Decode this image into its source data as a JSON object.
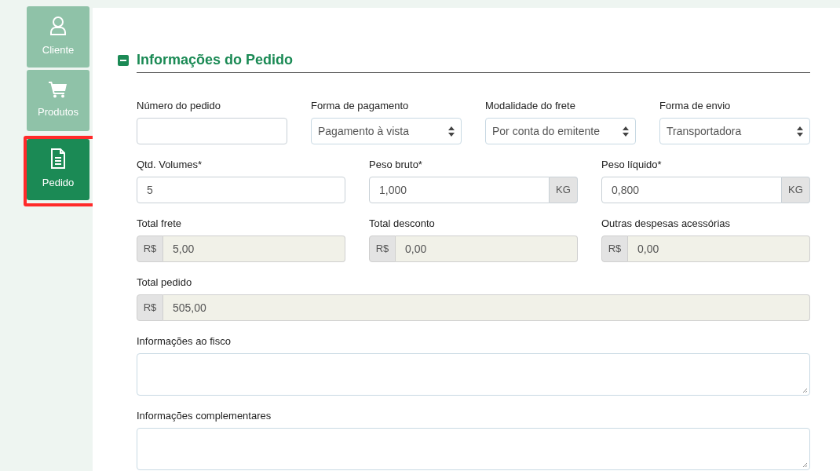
{
  "sidebar": {
    "items": [
      {
        "label": "Cliente",
        "selected": false,
        "highlighted": false
      },
      {
        "label": "Produtos",
        "selected": false,
        "highlighted": false
      },
      {
        "label": "Pedido",
        "selected": true,
        "highlighted": true
      }
    ]
  },
  "section": {
    "title": "Informações do Pedido",
    "expanded": true
  },
  "form_rows": [
    [
      {
        "kind": "text",
        "label": "Número do pedido"
      },
      {
        "kind": "select",
        "label": "Forma de pagamento",
        "value": "Pagamento à vista"
      },
      {
        "kind": "select",
        "label": "Modalidade do frete",
        "value": "Por conta do emitente"
      },
      {
        "kind": "select",
        "label": "Forma de envio",
        "value": "Transportadora"
      }
    ],
    [
      {
        "kind": "text",
        "label": "Qtd. Volumes*",
        "value": "5"
      },
      {
        "kind": "unit",
        "label": "Peso bruto*",
        "value": "1,000",
        "unit": "KG"
      },
      {
        "kind": "unit",
        "label": "Peso líquido*",
        "value": "0,800",
        "unit": "KG"
      }
    ],
    [
      {
        "kind": "prefix",
        "label": "Total frete",
        "prefix": "R$",
        "value": "5,00",
        "readonly": true
      },
      {
        "kind": "prefix",
        "label": "Total desconto",
        "prefix": "R$",
        "value": "0,00",
        "readonly": true
      },
      {
        "kind": "prefix",
        "label": "Outras despesas acessórias",
        "prefix": "R$",
        "value": "0,00",
        "readonly": true
      }
    ],
    [
      {
        "kind": "prefix",
        "label": "Total pedido",
        "prefix": "R$",
        "value": "505,00",
        "readonly": true
      }
    ],
    [
      {
        "kind": "textarea",
        "label": "Informações ao fisco"
      }
    ],
    [
      {
        "kind": "textarea",
        "label": "Informações complementares"
      }
    ]
  ]
}
